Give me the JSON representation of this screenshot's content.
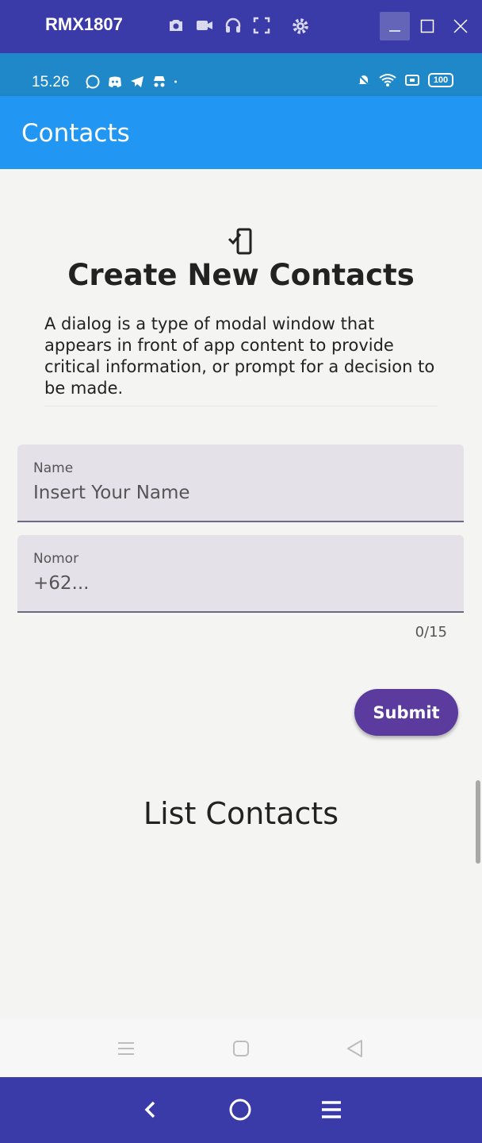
{
  "window": {
    "title": "RMX1807",
    "icons": [
      "camera-icon",
      "video-icon",
      "headphones-icon",
      "fullscreen-icon",
      "gear-icon"
    ],
    "controls": [
      "minimize-icon",
      "maximize-icon",
      "close-icon"
    ]
  },
  "status_bar": {
    "time": "15.26",
    "battery": "100",
    "left_icons": [
      "whatsapp-icon",
      "discord-icon",
      "telegram-icon",
      "incognito-icon",
      "dot-icon"
    ],
    "right_icons": [
      "mute-icon",
      "wifi-icon",
      "sim-icon",
      "battery-icon"
    ]
  },
  "app_bar": {
    "title": "Contacts"
  },
  "form": {
    "heading": "Create New Contacts",
    "description": "A dialog is a type of modal window that appears in front of app content to provide critical information, or prompt for a decision to be made.",
    "name_field": {
      "label": "Name",
      "placeholder": "Insert Your Name",
      "value": ""
    },
    "number_field": {
      "label": "Nomor",
      "placeholder": "+62...",
      "value": ""
    },
    "counter": "0/15",
    "submit_label": "Submit"
  },
  "list": {
    "heading": "List Contacts"
  },
  "colors": {
    "app_bar": "#2196f3",
    "status_bar": "#1e88c8",
    "window_bar": "#3a3aa8",
    "submit_button": "#5b3c9e",
    "field_bg": "#e4e1e9"
  }
}
